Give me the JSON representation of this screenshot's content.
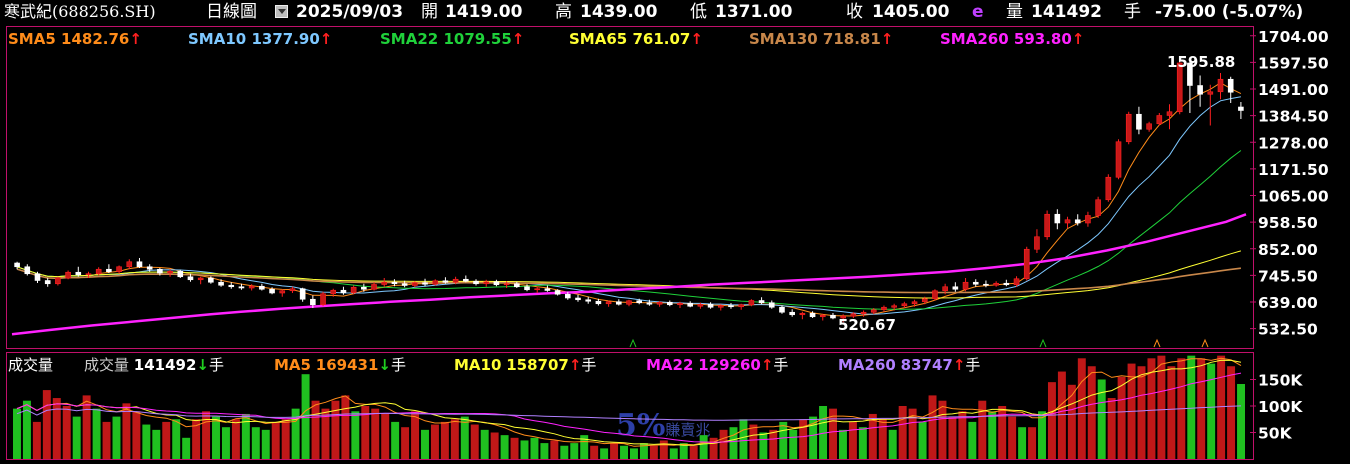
{
  "header": {
    "stock_name": "寒武紀(688256.SH)",
    "period": "日線圖",
    "date": "2025/09/03",
    "open_label": "開",
    "open": "1419.00",
    "high_label": "高",
    "high": "1439.00",
    "low_label": "低",
    "low": "1371.00",
    "close_label": "收",
    "close": "1405.00",
    "e_mark": "e",
    "volume_label": "量",
    "volume": "141492",
    "volume_unit": "手",
    "change": "-75.00 (-5.07%)"
  },
  "ma_legend": [
    {
      "label": "SMA5",
      "value": "1482.76",
      "arrow": "↑",
      "color": "#ff8c1a"
    },
    {
      "label": "SMA10",
      "value": "1377.90",
      "arrow": "↑",
      "color": "#7ec8ff"
    },
    {
      "label": "SMA22",
      "value": "1079.55",
      "arrow": "↑",
      "color": "#1fd13a"
    },
    {
      "label": "SMA65",
      "value": "761.07",
      "arrow": "↑",
      "color": "#ffff33"
    },
    {
      "label": "SMA130",
      "value": "718.81",
      "arrow": "↑",
      "color": "#c8874a"
    },
    {
      "label": "SMA260",
      "value": "593.80",
      "arrow": "↑",
      "color": "#ff22ff"
    }
  ],
  "volume_legend": {
    "title": "成交量",
    "items": [
      {
        "label": "成交量",
        "value": "141492",
        "arrow": "↓",
        "unit": "手",
        "color": "#ffffff"
      },
      {
        "label": "MA5",
        "value": "169431",
        "arrow": "↓",
        "unit": "手",
        "color": "#ff8c1a"
      },
      {
        "label": "MA10",
        "value": "158707",
        "arrow": "↑",
        "unit": "手",
        "color": "#ffff33"
      },
      {
        "label": "MA22",
        "value": "129260",
        "arrow": "↑",
        "unit": "手",
        "color": "#ff22ff"
      },
      {
        "label": "MA260",
        "value": "83747",
        "arrow": "↑",
        "unit": "手",
        "color": "#b080ff"
      }
    ]
  },
  "watermark": {
    "big": "5%",
    "small": "賺賣兆"
  },
  "colors": {
    "up": "#ff2020",
    "up_candle_body": "#c81818",
    "down": "#ffffff",
    "vol_up": "#c01818",
    "vol_down": "#20c020",
    "frame": "#c0106a"
  },
  "chart_data": {
    "type": "candlestick",
    "period": "daily",
    "last_date": "2025/09/03",
    "price_axis_ticks": [
      "1704.00",
      "1597.50",
      "1491.00",
      "1384.50",
      "1278.00",
      "1171.50",
      "1065.00",
      "958.50",
      "852.00",
      "745.50",
      "639.00",
      "532.50"
    ],
    "price_ylim": [
      455,
      1735
    ],
    "annotations": [
      {
        "label": "1595.88",
        "kind": "high"
      },
      {
        "label": "520.67",
        "kind": "low"
      }
    ],
    "volume_axis_ticks": [
      "150K",
      "100K",
      "50K"
    ],
    "volume_ylim": [
      0,
      200000
    ],
    "candles": [
      [
        795,
        800,
        770,
        780
      ],
      [
        780,
        790,
        745,
        752
      ],
      [
        752,
        760,
        715,
        725
      ],
      [
        725,
        735,
        700,
        712
      ],
      [
        712,
        740,
        705,
        735
      ],
      [
        735,
        765,
        730,
        758
      ],
      [
        758,
        780,
        740,
        748
      ],
      [
        748,
        760,
        735,
        752
      ],
      [
        752,
        778,
        745,
        770
      ],
      [
        770,
        790,
        755,
        760
      ],
      [
        760,
        785,
        752,
        780
      ],
      [
        780,
        810,
        770,
        800
      ],
      [
        800,
        815,
        775,
        780
      ],
      [
        780,
        790,
        760,
        770
      ],
      [
        770,
        775,
        745,
        755
      ],
      [
        755,
        770,
        740,
        762
      ],
      [
        762,
        768,
        735,
        740
      ],
      [
        740,
        752,
        720,
        728
      ],
      [
        728,
        740,
        710,
        735
      ],
      [
        735,
        742,
        712,
        718
      ],
      [
        718,
        730,
        700,
        706
      ],
      [
        706,
        718,
        692,
        700
      ],
      [
        700,
        712,
        688,
        695
      ],
      [
        695,
        710,
        685,
        702
      ],
      [
        702,
        712,
        685,
        690
      ],
      [
        690,
        698,
        670,
        675
      ],
      [
        675,
        690,
        660,
        684
      ],
      [
        684,
        700,
        675,
        692
      ],
      [
        692,
        696,
        640,
        650
      ],
      [
        650,
        665,
        615,
        628
      ],
      [
        628,
        680,
        622,
        672
      ],
      [
        672,
        692,
        660,
        686
      ],
      [
        686,
        700,
        668,
        676
      ],
      [
        676,
        705,
        670,
        698
      ],
      [
        698,
        712,
        680,
        690
      ],
      [
        690,
        718,
        685,
        709
      ],
      [
        709,
        735,
        700,
        718
      ],
      [
        718,
        730,
        702,
        712
      ],
      [
        712,
        724,
        698,
        705
      ],
      [
        705,
        722,
        698,
        716
      ],
      [
        716,
        732,
        702,
        710
      ],
      [
        710,
        730,
        705,
        724
      ],
      [
        724,
        738,
        712,
        718
      ],
      [
        718,
        740,
        710,
        730
      ],
      [
        730,
        745,
        718,
        722
      ],
      [
        722,
        730,
        705,
        712
      ],
      [
        712,
        728,
        700,
        720
      ],
      [
        720,
        728,
        702,
        708
      ],
      [
        708,
        722,
        695,
        712
      ],
      [
        712,
        720,
        695,
        700
      ],
      [
        700,
        710,
        682,
        688
      ],
      [
        688,
        700,
        675,
        692
      ],
      [
        692,
        705,
        680,
        685
      ],
      [
        685,
        690,
        665,
        670
      ],
      [
        670,
        680,
        648,
        655
      ],
      [
        655,
        668,
        640,
        648
      ],
      [
        648,
        660,
        632,
        642
      ],
      [
        642,
        652,
        625,
        632
      ],
      [
        632,
        645,
        620,
        640
      ],
      [
        640,
        650,
        625,
        630
      ],
      [
        630,
        648,
        622,
        644
      ],
      [
        644,
        652,
        630,
        636
      ],
      [
        636,
        648,
        624,
        630
      ],
      [
        630,
        642,
        620,
        638
      ],
      [
        638,
        645,
        622,
        628
      ],
      [
        628,
        640,
        615,
        634
      ],
      [
        634,
        642,
        618,
        622
      ],
      [
        622,
        636,
        612,
        630
      ],
      [
        630,
        638,
        612,
        618
      ],
      [
        618,
        630,
        605,
        625
      ],
      [
        625,
        635,
        612,
        620
      ],
      [
        620,
        632,
        608,
        628
      ],
      [
        628,
        650,
        622,
        645
      ],
      [
        645,
        658,
        630,
        636
      ],
      [
        636,
        645,
        612,
        618
      ],
      [
        618,
        625,
        592,
        598
      ],
      [
        598,
        610,
        580,
        588
      ],
      [
        588,
        600,
        570,
        594
      ],
      [
        594,
        602,
        575,
        580
      ],
      [
        580,
        592,
        565,
        586
      ],
      [
        586,
        595,
        570,
        575
      ],
      [
        575,
        590,
        558,
        582
      ],
      [
        582,
        598,
        575,
        592
      ],
      [
        592,
        605,
        580,
        598
      ],
      [
        598,
        615,
        590,
        608
      ],
      [
        608,
        625,
        600,
        618
      ],
      [
        618,
        632,
        605,
        624
      ],
      [
        624,
        640,
        615,
        632
      ],
      [
        632,
        648,
        620,
        640
      ],
      [
        640,
        660,
        630,
        652
      ],
      [
        652,
        690,
        645,
        684
      ],
      [
        684,
        712,
        670,
        700
      ],
      [
        700,
        718,
        680,
        690
      ],
      [
        690,
        735,
        682,
        718
      ],
      [
        718,
        730,
        700,
        710
      ],
      [
        710,
        725,
        698,
        706
      ],
      [
        706,
        722,
        700,
        714
      ],
      [
        714,
        728,
        702,
        708
      ],
      [
        708,
        742,
        700,
        732
      ],
      [
        732,
        860,
        725,
        850
      ],
      [
        850,
        930,
        835,
        900
      ],
      [
        900,
        1005,
        888,
        990
      ],
      [
        990,
        1010,
        930,
        955
      ],
      [
        955,
        980,
        935,
        968
      ],
      [
        968,
        990,
        945,
        955
      ],
      [
        955,
        1000,
        940,
        985
      ],
      [
        985,
        1060,
        975,
        1048
      ],
      [
        1048,
        1150,
        1040,
        1138
      ],
      [
        1138,
        1290,
        1130,
        1280
      ],
      [
        1280,
        1400,
        1270,
        1390
      ],
      [
        1390,
        1420,
        1310,
        1330
      ],
      [
        1330,
        1360,
        1320,
        1352
      ],
      [
        1352,
        1395,
        1345,
        1385
      ],
      [
        1385,
        1430,
        1330,
        1400
      ],
      [
        1400,
        1600,
        1390,
        1595
      ],
      [
        1595,
        1605,
        1395,
        1505
      ],
      [
        1505,
        1545,
        1420,
        1470
      ],
      [
        1470,
        1508,
        1345,
        1480
      ],
      [
        1480,
        1555,
        1450,
        1530
      ],
      [
        1530,
        1540,
        1435,
        1478
      ],
      [
        1419,
        1439,
        1371,
        1405
      ]
    ],
    "sma260": [
      [
        0,
        510
      ],
      [
        40,
        528
      ],
      [
        80,
        545
      ],
      [
        120,
        560
      ],
      [
        160,
        575
      ],
      [
        200,
        590
      ],
      [
        230,
        600
      ],
      [
        270,
        612
      ],
      [
        300,
        620
      ],
      [
        340,
        630
      ],
      [
        380,
        640
      ],
      [
        420,
        648
      ],
      [
        460,
        658
      ],
      [
        500,
        666
      ],
      [
        540,
        674
      ],
      [
        580,
        680
      ],
      [
        620,
        690
      ],
      [
        660,
        698
      ],
      [
        700,
        708
      ],
      [
        740,
        716
      ],
      [
        780,
        724
      ],
      [
        820,
        732
      ],
      [
        860,
        740
      ],
      [
        900,
        750
      ],
      [
        940,
        760
      ],
      [
        980,
        775
      ],
      [
        1020,
        792
      ],
      [
        1060,
        815
      ],
      [
        1100,
        845
      ],
      [
        1140,
        880
      ],
      [
        1180,
        920
      ],
      [
        1220,
        960
      ],
      [
        1240,
        990
      ]
    ],
    "volumes": [
      [
        95000,
        0
      ],
      [
        110000,
        0
      ],
      [
        70000,
        1
      ],
      [
        130000,
        1
      ],
      [
        115000,
        1
      ],
      [
        100000,
        1
      ],
      [
        80000,
        0
      ],
      [
        120000,
        1
      ],
      [
        95000,
        0
      ],
      [
        70000,
        1
      ],
      [
        80000,
        0
      ],
      [
        105000,
        1
      ],
      [
        90000,
        1
      ],
      [
        65000,
        0
      ],
      [
        55000,
        0
      ],
      [
        70000,
        1
      ],
      [
        75000,
        0
      ],
      [
        40000,
        0
      ],
      [
        75000,
        1
      ],
      [
        90000,
        1
      ],
      [
        80000,
        0
      ],
      [
        60000,
        0
      ],
      [
        75000,
        1
      ],
      [
        85000,
        0
      ],
      [
        60000,
        0
      ],
      [
        55000,
        0
      ],
      [
        70000,
        1
      ],
      [
        75000,
        1
      ],
      [
        95000,
        0
      ],
      [
        160000,
        0
      ],
      [
        110000,
        1
      ],
      [
        95000,
        1
      ],
      [
        110000,
        1
      ],
      [
        120000,
        1
      ],
      [
        90000,
        0
      ],
      [
        100000,
        1
      ],
      [
        95000,
        1
      ],
      [
        85000,
        1
      ],
      [
        70000,
        0
      ],
      [
        60000,
        1
      ],
      [
        90000,
        1
      ],
      [
        55000,
        0
      ],
      [
        65000,
        1
      ],
      [
        70000,
        1
      ],
      [
        75000,
        1
      ],
      [
        80000,
        0
      ],
      [
        65000,
        1
      ],
      [
        55000,
        0
      ],
      [
        50000,
        1
      ],
      [
        45000,
        0
      ],
      [
        40000,
        1
      ],
      [
        35000,
        0
      ],
      [
        40000,
        0
      ],
      [
        30000,
        0
      ],
      [
        35000,
        1
      ],
      [
        25000,
        0
      ],
      [
        30000,
        0
      ],
      [
        45000,
        0
      ],
      [
        25000,
        1
      ],
      [
        20000,
        0
      ],
      [
        30000,
        1
      ],
      [
        25000,
        0
      ],
      [
        20000,
        0
      ],
      [
        30000,
        0
      ],
      [
        25000,
        1
      ],
      [
        35000,
        1
      ],
      [
        20000,
        0
      ],
      [
        30000,
        0
      ],
      [
        25000,
        1
      ],
      [
        45000,
        0
      ],
      [
        40000,
        1
      ],
      [
        55000,
        1
      ],
      [
        60000,
        0
      ],
      [
        75000,
        0
      ],
      [
        65000,
        1
      ],
      [
        50000,
        0
      ],
      [
        55000,
        1
      ],
      [
        70000,
        0
      ],
      [
        55000,
        0
      ],
      [
        75000,
        1
      ],
      [
        80000,
        0
      ],
      [
        100000,
        0
      ],
      [
        95000,
        1
      ],
      [
        55000,
        0
      ],
      [
        70000,
        1
      ],
      [
        60000,
        0
      ],
      [
        85000,
        1
      ],
      [
        75000,
        1
      ],
      [
        55000,
        0
      ],
      [
        100000,
        1
      ],
      [
        95000,
        1
      ],
      [
        70000,
        0
      ],
      [
        120000,
        1
      ],
      [
        110000,
        1
      ],
      [
        80000,
        1
      ],
      [
        90000,
        1
      ],
      [
        70000,
        0
      ],
      [
        110000,
        1
      ],
      [
        90000,
        0
      ],
      [
        100000,
        1
      ],
      [
        80000,
        1
      ],
      [
        60000,
        0
      ],
      [
        60000,
        1
      ],
      [
        90000,
        0
      ],
      [
        145000,
        1
      ],
      [
        165000,
        1
      ],
      [
        140000,
        1
      ],
      [
        190000,
        1
      ],
      [
        175000,
        1
      ],
      [
        150000,
        0
      ],
      [
        115000,
        1
      ],
      [
        155000,
        1
      ],
      [
        180000,
        1
      ],
      [
        175000,
        1
      ],
      [
        190000,
        1
      ],
      [
        195000,
        1
      ],
      [
        175000,
        1
      ],
      [
        190000,
        1
      ],
      [
        195000,
        0
      ],
      [
        190000,
        1
      ],
      [
        180000,
        0
      ],
      [
        195000,
        1
      ],
      [
        175000,
        1
      ],
      [
        141492,
        0
      ]
    ]
  }
}
